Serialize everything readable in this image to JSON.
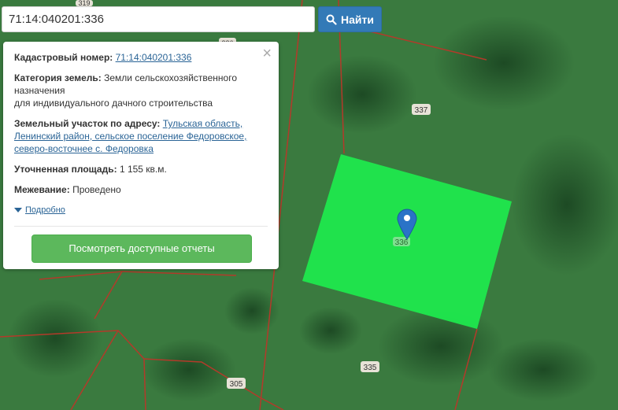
{
  "search": {
    "value": "71:14:040201:336",
    "button_label": "Найти",
    "button_icon": "search-icon"
  },
  "popup": {
    "cadastral_label": "Кадастровый номер:",
    "cadastral_value": "71:14:040201:336",
    "category_label": "Категория земель:",
    "category_value_1": "Земли сельскохозяйственного",
    "category_value_2": "назначения",
    "category_value_3": "для индивидуального дачного строительства",
    "address_label": "Земельный участок по адресу:",
    "address_value_1": "Тульская область,",
    "address_value_2": "Ленинский район, сельское поселение Федоровское,",
    "address_value_3": "северо-восточнее с. Федоровка",
    "area_label": "Уточненная площадь:",
    "area_value": "1 155 кв.м.",
    "survey_label": "Межевание:",
    "survey_value": "Проведено",
    "more_label": "Подробно",
    "reports_button": "Посмотреть доступные отчеты",
    "close_icon": "close-icon"
  },
  "map": {
    "parcel_labels": [
      "319",
      "336",
      "337",
      "336",
      "335",
      "305"
    ],
    "colors": {
      "imagery": "#2f6b34",
      "parcel_fill": "#1fe84d",
      "boundary": "#b33a2a",
      "marker": "#2a73c7"
    },
    "marker_icon": "map-pin-icon"
  }
}
